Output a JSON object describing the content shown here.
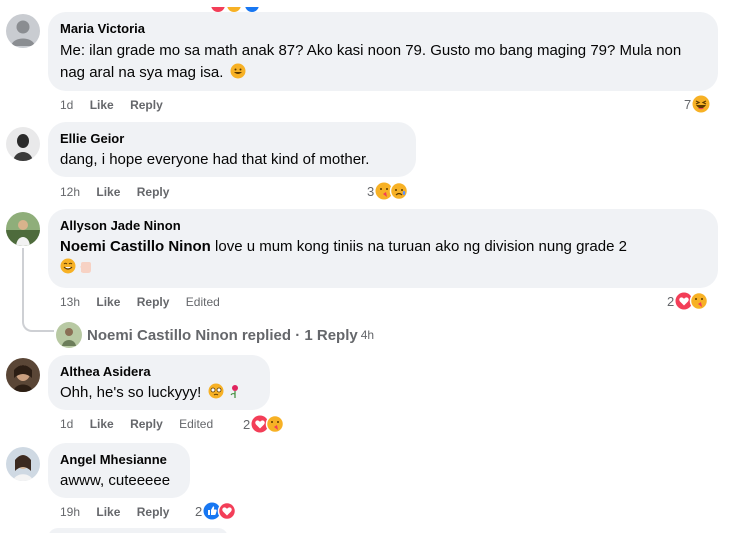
{
  "comments": [
    {
      "author": "Maria Victoria",
      "text": "Me: ilan grade mo sa math anak 87? Ako kasi noon 79. Gusto mo bang maging 79? Mula non nag aral na sya mag isa.",
      "time": "1d",
      "like": "Like",
      "reply": "Reply",
      "reaction_count": "7",
      "reactions": [
        "haha"
      ]
    },
    {
      "author": "Ellie Geior",
      "text": "dang, i hope everyone had that kind of mother.",
      "time": "12h",
      "like": "Like",
      "reply": "Reply",
      "reaction_count": "3",
      "reactions": [
        "care",
        "sad"
      ]
    },
    {
      "author": "Allyson Jade Ninon",
      "mention": "Noemi Castillo Ninon",
      "text": "love u mum kong tiniis na turuan ako ng division nung grade 2",
      "time": "13h",
      "like": "Like",
      "reply": "Reply",
      "edited": "Edited",
      "reaction_count": "2",
      "reactions": [
        "love",
        "care"
      ],
      "replies_summary": {
        "name": "Noemi Castillo Ninon",
        "label": "replied · 1 Reply",
        "time": "4h"
      }
    },
    {
      "author": "Althea Asidera",
      "text": "Ohh, he's so luckyyy!",
      "time": "1d",
      "like": "Like",
      "reply": "Reply",
      "edited": "Edited",
      "reaction_count": "2",
      "reactions": [
        "love",
        "care"
      ]
    },
    {
      "author": "Angel Mhesianne",
      "text": "awww, cuteeeee",
      "time": "19h",
      "like": "Like",
      "reply": "Reply",
      "reaction_count": "2",
      "reactions": [
        "like",
        "love"
      ]
    }
  ],
  "colors": {
    "like": "#1877f2",
    "love": "#f33e58",
    "haha": "#f7b125",
    "meta": "#65676b",
    "bubble": "#f0f2f5"
  }
}
